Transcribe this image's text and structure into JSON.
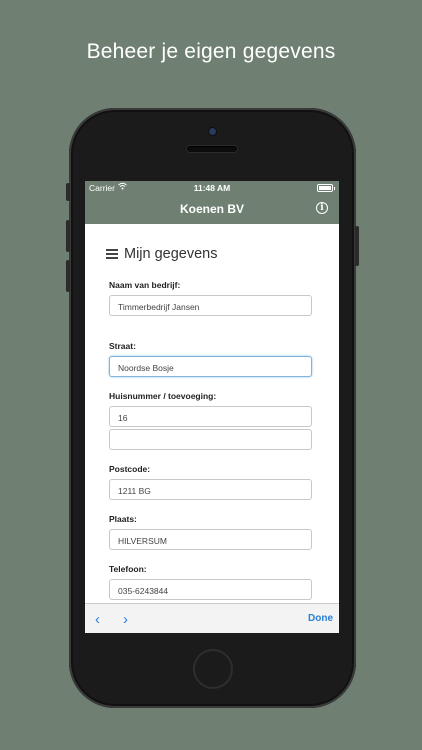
{
  "headline": "Beheer je eigen gegevens",
  "colors": {
    "background": "#6f8072",
    "accent": "#2b7fd6"
  },
  "statusbar": {
    "carrier": "Carrier",
    "time": "11:48 AM"
  },
  "navbar": {
    "title": "Koenen BV",
    "info_icon": "i"
  },
  "section": {
    "title": "Mijn gegevens"
  },
  "form": {
    "company": {
      "label": "Naam van bedrijf:",
      "value": "Timmerbedrijf Jansen"
    },
    "street": {
      "label": "Straat:",
      "value": "Noordse Bosje"
    },
    "housenumber": {
      "label": "Huisnummer / toevoeging:",
      "value": "16",
      "addition": ""
    },
    "postcode": {
      "label": "Postcode:",
      "value": "1211 BG"
    },
    "city": {
      "label": "Plaats:",
      "value": "HILVERSUM"
    },
    "phone": {
      "label": "Telefoon:",
      "value": "035-6243844"
    }
  },
  "toolbar": {
    "prev": "‹",
    "next": "›",
    "done_label": "Done"
  }
}
